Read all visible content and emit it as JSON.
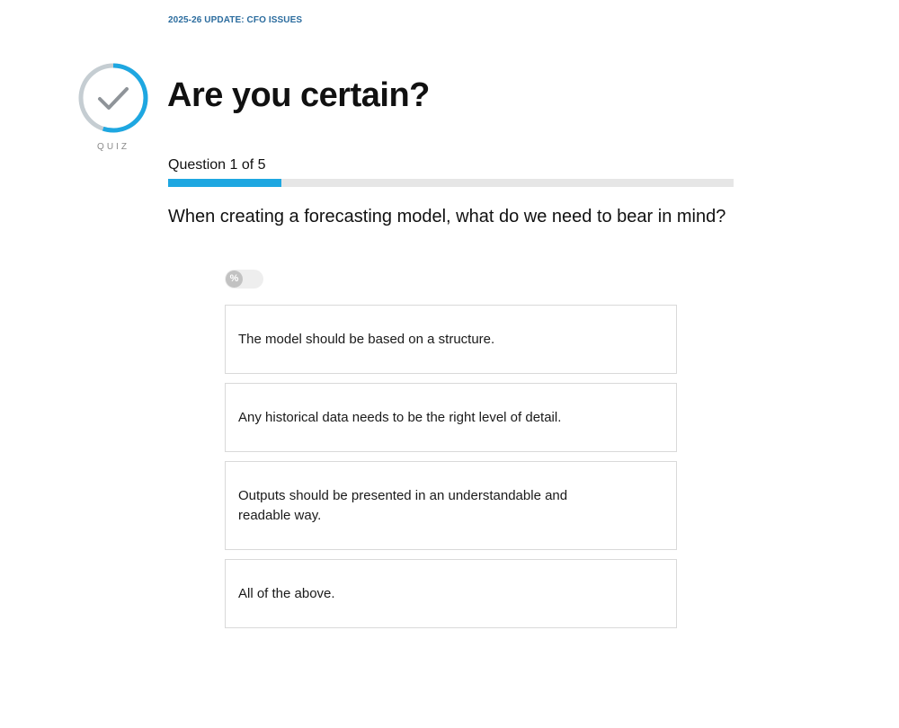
{
  "header": {
    "breadcrumb": "2025-26 UPDATE: CFO ISSUES"
  },
  "badge": {
    "icon": "checkmark-icon",
    "label": "QUIZ",
    "ring_progress": 0.55,
    "colors": {
      "ring_track": "#c5cdd2",
      "ring_fill": "#1ea7e1",
      "check": "#8f9499"
    }
  },
  "title": "Are you certain?",
  "progress": {
    "text": "Question 1 of 5",
    "current": 1,
    "total": 5,
    "fraction": 0.2,
    "color": "#1ea7e1"
  },
  "question": {
    "text": "When creating a forecasting model, what do we need to bear in mind?"
  },
  "percent_toggle": {
    "symbol": "%",
    "state": "off"
  },
  "answers": [
    {
      "text": "The model should be based on a structure."
    },
    {
      "text": "Any historical data needs to be the right level of detail."
    },
    {
      "text": "Outputs should be presented in an understandable and readable way."
    },
    {
      "text": "All of the above."
    }
  ]
}
